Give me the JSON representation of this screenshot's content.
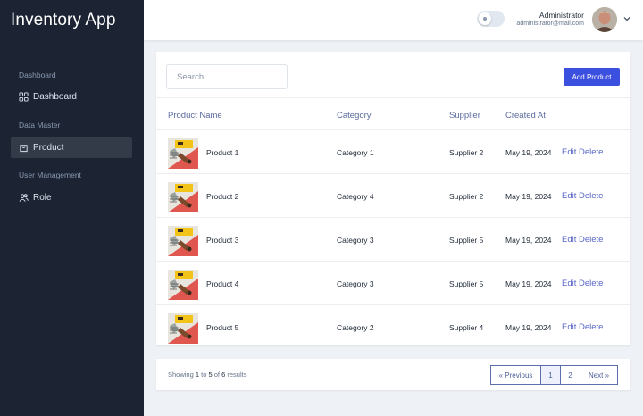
{
  "app": {
    "title": "Inventory App"
  },
  "sidebar": {
    "sections": [
      {
        "label": "Dashboard",
        "items": [
          {
            "label": "Dashboard",
            "icon": "grid-icon",
            "active": false
          }
        ]
      },
      {
        "label": "Data Master",
        "items": [
          {
            "label": "Product",
            "icon": "bag-icon",
            "active": true
          }
        ]
      },
      {
        "label": "User Management",
        "items": [
          {
            "label": "Role",
            "icon": "users-icon",
            "active": false
          }
        ]
      }
    ]
  },
  "header": {
    "user_name": "Administrator",
    "user_email": "administrator@mail.com",
    "theme_toggle_icon": "theme-toggle-icon",
    "dropdown_icon": "chevron-down-icon"
  },
  "toolbar": {
    "search_placeholder": "Search...",
    "search_value": "",
    "add_label": "Add Product"
  },
  "table": {
    "columns": [
      "Product Name",
      "Category",
      "Supplier",
      "Created At"
    ],
    "rows": [
      {
        "name": "Product 1",
        "category": "Category 1",
        "supplier": "Supplier 2",
        "created": "May 19, 2024",
        "edit": "Edit",
        "delete": "Delete"
      },
      {
        "name": "Product 2",
        "category": "Category 4",
        "supplier": "Supplier 2",
        "created": "May 19, 2024",
        "edit": "Edit",
        "delete": "Delete"
      },
      {
        "name": "Product 3",
        "category": "Category 3",
        "supplier": "Supplier 5",
        "created": "May 19, 2024",
        "edit": "Edit",
        "delete": "Delete"
      },
      {
        "name": "Product 4",
        "category": "Category 3",
        "supplier": "Supplier 5",
        "created": "May 19, 2024",
        "edit": "Edit",
        "delete": "Delete"
      },
      {
        "name": "Product 5",
        "category": "Category 2",
        "supplier": "Supplier 4",
        "created": "May 19, 2024",
        "edit": "Edit",
        "delete": "Delete"
      }
    ]
  },
  "pagination": {
    "showing_prefix": "Showing",
    "from": "1",
    "to_word": "to",
    "to": "5",
    "of_word": "of",
    "total": "6",
    "suffix": "results",
    "previous": "« Previous",
    "pages": [
      "1",
      "2"
    ],
    "current_page": "1",
    "next": "Next »"
  },
  "colors": {
    "sidebar_bg": "#1c2434",
    "primary": "#3c50e0",
    "link": "#5966c8",
    "page_bg": "#eef1f5"
  }
}
